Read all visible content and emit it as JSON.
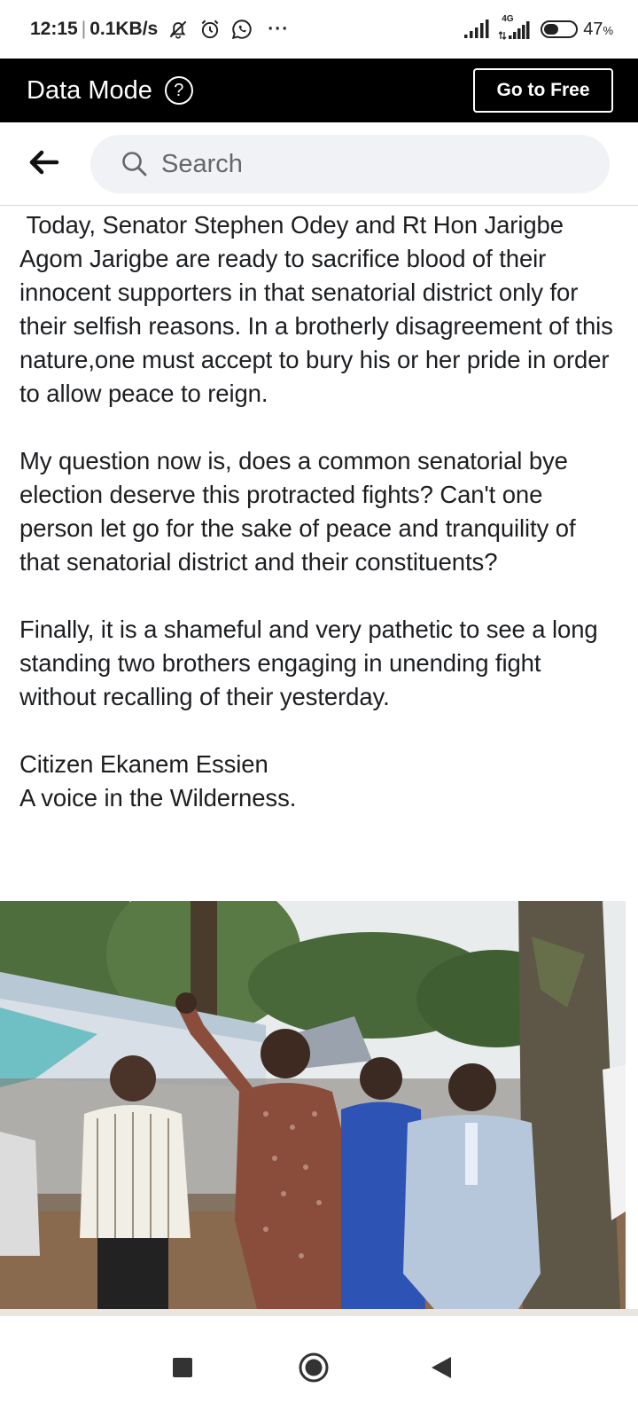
{
  "status_bar": {
    "time": "12:15",
    "separator": "|",
    "speed": "0.1KB/s",
    "overflow": "···",
    "network_label": "4G",
    "battery_percent": "47",
    "battery_unit": "%",
    "battery_level": 0.47,
    "icons": [
      "muted-bell-icon",
      "alarm-icon",
      "whatsapp-icon",
      "signal-icon",
      "signal-4g-icon",
      "battery-icon"
    ]
  },
  "data_mode": {
    "label": "Data Mode",
    "help_symbol": "?",
    "button_label": "Go to Free"
  },
  "search": {
    "placeholder": "Search"
  },
  "post": {
    "paragraphs": [
      " Today, Senator Stephen Odey and Rt Hon Jarigbe Agom Jarigbe are ready to sacrifice blood of their innocent supporters in that senatorial district only for their selfish reasons. In a brotherly disagreement of this nature,one must accept to bury his or her pride in order to allow peace to reign.",
      "My question now is, does a common senatorial bye election deserve this protracted fights? Can't one person let go for the sake of peace and tranquility of that senatorial district and their constituents?",
      "Finally, it is a shameful and very pathetic to see a long standing two brothers engaging in unending fight without recalling of their yesterday."
    ],
    "signature_name": "Citizen Ekanem Essien",
    "signature_tagline": "A voice in the Wilderness."
  },
  "nav": {
    "icons": [
      "recents-square-icon",
      "home-circle-icon",
      "back-triangle-icon"
    ]
  },
  "colors": {
    "data_mode_bg": "#000000",
    "search_bg": "#f0f2f5",
    "text": "#1c1e21"
  }
}
